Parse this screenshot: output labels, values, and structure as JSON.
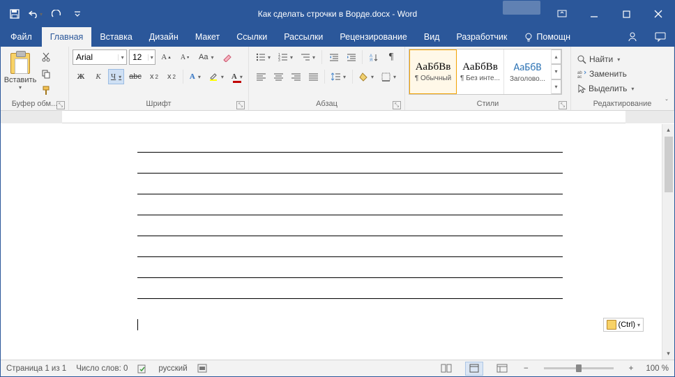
{
  "titlebar": {
    "title": "Как сделать строчки в Ворде.docx - Word"
  },
  "tabs": {
    "file": "Файл",
    "items": [
      "Главная",
      "Вставка",
      "Дизайн",
      "Макет",
      "Ссылки",
      "Рассылки",
      "Рецензирование",
      "Вид",
      "Разработчик"
    ],
    "active": 0,
    "tellme": "Помощн"
  },
  "ribbon": {
    "clipboard": {
      "paste": "Вставить",
      "label": "Буфер обм..."
    },
    "font": {
      "name": "Arial",
      "size": "12",
      "label": "Шрифт",
      "bold": "Ж",
      "italic": "К",
      "underline": "Ч",
      "strike": "abc",
      "sub": "x₂",
      "sup": "x²"
    },
    "paragraph": {
      "label": "Абзац"
    },
    "styles": {
      "label": "Стили",
      "items": [
        {
          "preview": "АаБбВв",
          "name": "¶ Обычный",
          "color": "#000",
          "sel": true
        },
        {
          "preview": "АаБбВв",
          "name": "¶ Без инте...",
          "color": "#000",
          "sel": false
        },
        {
          "preview": "АаБбВ",
          "name": "Заголово...",
          "color": "#2e74b5",
          "sel": false
        }
      ]
    },
    "editing": {
      "label": "Редактирование",
      "find": "Найти",
      "replace": "Заменить",
      "select": "Выделить"
    }
  },
  "ctrl_tip": "(Ctrl)",
  "status": {
    "page": "Страница 1 из 1",
    "words": "Число слов: 0",
    "lang": "русский",
    "zoom": "100 %"
  }
}
